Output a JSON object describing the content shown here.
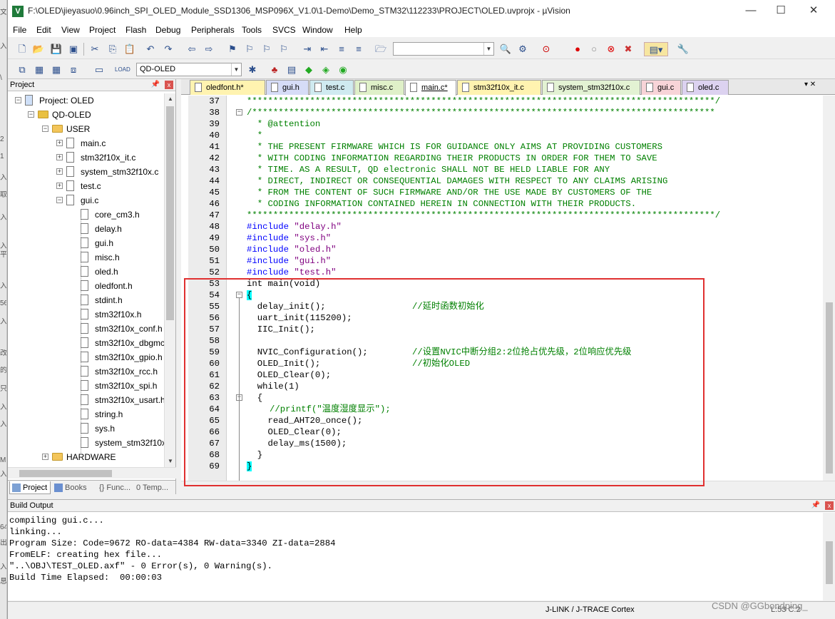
{
  "window": {
    "title": "F:\\OLED\\jieyasuo\\0.96inch_SPI_OLED_Module_SSD1306_MSP096X_V1.0\\1-Demo\\Demo_STM32\\112233\\PROJECT\\OLED.uvprojx - µVision",
    "app_icon": "V",
    "minimize": "—",
    "maximize": "☐",
    "close": "✕"
  },
  "left_strip": [
    "文",
    "入",
    "\\",
    "2",
    "1",
    "入",
    "取",
    "入",
    "入",
    "平",
    "入",
    "56",
    "入",
    "改",
    "的",
    "只",
    "入",
    "入",
    "M",
    "入",
    "64",
    "出",
    "入",
    "息"
  ],
  "menu": [
    "File",
    "Edit",
    "View",
    "Project",
    "Flash",
    "Debug",
    "Peripherals",
    "Tools",
    "SVCS",
    "Window",
    "Help"
  ],
  "toolbar": {
    "target_name": "QD-OLED"
  },
  "project_panel": {
    "title": "Project",
    "pin": "📌",
    "close": "x",
    "tree": [
      {
        "label": "Project: OLED",
        "level": 0,
        "kind": "root",
        "expand": "−"
      },
      {
        "label": "QD-OLED",
        "level": 1,
        "kind": "target",
        "expand": "−"
      },
      {
        "label": "USER",
        "level": 2,
        "kind": "folder",
        "expand": "−"
      },
      {
        "label": "main.c",
        "level": 3,
        "kind": "file",
        "expand": "+"
      },
      {
        "label": "stm32f10x_it.c",
        "level": 3,
        "kind": "file",
        "expand": "+"
      },
      {
        "label": "system_stm32f10x.c",
        "level": 3,
        "kind": "file",
        "expand": "+"
      },
      {
        "label": "test.c",
        "level": 3,
        "kind": "file",
        "expand": "+"
      },
      {
        "label": "gui.c",
        "level": 3,
        "kind": "file",
        "expand": "−"
      },
      {
        "label": "core_cm3.h",
        "level": 4,
        "kind": "header",
        "expand": ""
      },
      {
        "label": "delay.h",
        "level": 4,
        "kind": "header",
        "expand": ""
      },
      {
        "label": "gui.h",
        "level": 4,
        "kind": "header",
        "expand": ""
      },
      {
        "label": "misc.h",
        "level": 4,
        "kind": "header",
        "expand": ""
      },
      {
        "label": "oled.h",
        "level": 4,
        "kind": "header",
        "expand": ""
      },
      {
        "label": "oledfont.h",
        "level": 4,
        "kind": "header",
        "expand": ""
      },
      {
        "label": "stdint.h",
        "level": 4,
        "kind": "header",
        "expand": ""
      },
      {
        "label": "stm32f10x.h",
        "level": 4,
        "kind": "header",
        "expand": ""
      },
      {
        "label": "stm32f10x_conf.h",
        "level": 4,
        "kind": "header",
        "expand": ""
      },
      {
        "label": "stm32f10x_dbgmc",
        "level": 4,
        "kind": "header",
        "expand": ""
      },
      {
        "label": "stm32f10x_gpio.h",
        "level": 4,
        "kind": "header",
        "expand": ""
      },
      {
        "label": "stm32f10x_rcc.h",
        "level": 4,
        "kind": "header",
        "expand": ""
      },
      {
        "label": "stm32f10x_spi.h",
        "level": 4,
        "kind": "header",
        "expand": ""
      },
      {
        "label": "stm32f10x_usart.h",
        "level": 4,
        "kind": "header",
        "expand": ""
      },
      {
        "label": "string.h",
        "level": 4,
        "kind": "header",
        "expand": ""
      },
      {
        "label": "sys.h",
        "level": 4,
        "kind": "header",
        "expand": ""
      },
      {
        "label": "system_stm32f10x",
        "level": 4,
        "kind": "header",
        "expand": ""
      },
      {
        "label": "HARDWARE",
        "level": 2,
        "kind": "folder",
        "expand": "+"
      }
    ],
    "tabs": [
      "Project",
      "Books",
      "{} Func...",
      "0 Temp..."
    ]
  },
  "editor": {
    "tabs": [
      {
        "label": "oledfont.h*",
        "color": "#fff3b0"
      },
      {
        "label": "gui.h",
        "color": "#d6dcf7"
      },
      {
        "label": "test.c",
        "color": "#cfeaf0"
      },
      {
        "label": "misc.c",
        "color": "#dff0c8"
      },
      {
        "label": "main.c*",
        "color": "#ffffff",
        "active": true
      },
      {
        "label": "stm32f10x_it.c",
        "color": "#fff3b0"
      },
      {
        "label": "system_stm32f10x.c",
        "color": "#e3f2d3"
      },
      {
        "label": "gui.c",
        "color": "#f8d4d8"
      },
      {
        "label": "oled.c",
        "color": "#dcd2f0"
      }
    ],
    "tab_controls": "▾ ✕",
    "lines": [
      {
        "n": "37",
        "fold": "",
        "style": "green",
        "text": "*****************************************************************************************/"
      },
      {
        "n": "38",
        "fold": "−",
        "style": "green",
        "text": "/****************************************************************************************"
      },
      {
        "n": "39",
        "fold": "",
        "style": "green",
        "text": "  * @attention"
      },
      {
        "n": "40",
        "fold": "",
        "style": "green",
        "text": "  *"
      },
      {
        "n": "41",
        "fold": "",
        "style": "green",
        "text": "  * THE PRESENT FIRMWARE WHICH IS FOR GUIDANCE ONLY AIMS AT PROVIDING CUSTOMERS"
      },
      {
        "n": "42",
        "fold": "",
        "style": "green",
        "text": "  * WITH CODING INFORMATION REGARDING THEIR PRODUCTS IN ORDER FOR THEM TO SAVE"
      },
      {
        "n": "43",
        "fold": "",
        "style": "green",
        "text": "  * TIME. AS A RESULT, QD electronic SHALL NOT BE HELD LIABLE FOR ANY"
      },
      {
        "n": "44",
        "fold": "",
        "style": "green",
        "text": "  * DIRECT, INDIRECT OR CONSEQUENTIAL DAMAGES WITH RESPECT TO ANY CLAIMS ARISING"
      },
      {
        "n": "45",
        "fold": "",
        "style": "green",
        "text": "  * FROM THE CONTENT OF SUCH FIRMWARE AND/OR THE USE MADE BY CUSTOMERS OF THE"
      },
      {
        "n": "46",
        "fold": "",
        "style": "green",
        "text": "  * CODING INFORMATION CONTAINED HEREIN IN CONNECTION WITH THEIR PRODUCTS."
      },
      {
        "n": "47",
        "fold": "",
        "style": "green",
        "text": "*****************************************************************************************/"
      },
      {
        "n": "48",
        "fold": "",
        "style": "include",
        "kw": "#include ",
        "str": "\"delay.h\""
      },
      {
        "n": "49",
        "fold": "",
        "style": "include",
        "kw": "#include ",
        "str": "\"sys.h\""
      },
      {
        "n": "50",
        "fold": "",
        "style": "include",
        "kw": "#include ",
        "str": "\"oled.h\""
      },
      {
        "n": "51",
        "fold": "",
        "style": "include",
        "kw": "#include ",
        "str": "\"gui.h\""
      },
      {
        "n": "52",
        "fold": "",
        "style": "include",
        "kw": "#include ",
        "str": "\"test.h\""
      },
      {
        "n": "53",
        "fold": "",
        "style": "plain",
        "text": "int main(void)"
      },
      {
        "n": "54",
        "fold": "−",
        "style": "brace",
        "text": "{"
      },
      {
        "n": "55",
        "fold": "",
        "style": "code",
        "code": "  delay_init();",
        "comment": "//延时函数初始化"
      },
      {
        "n": "56",
        "fold": "",
        "style": "code",
        "code": "  uart_init(115200);",
        "comment": ""
      },
      {
        "n": "57",
        "fold": "",
        "style": "code",
        "code": "  IIC_Init();",
        "comment": ""
      },
      {
        "n": "58",
        "fold": "",
        "style": "code",
        "code": "",
        "comment": ""
      },
      {
        "n": "59",
        "fold": "",
        "style": "code",
        "code": "  NVIC_Configuration();",
        "comment": "//设置NVIC中断分组2:2位抢占优先级，2位响应优先级"
      },
      {
        "n": "60",
        "fold": "",
        "style": "code",
        "code": "  OLED_Init();",
        "comment": "//初始化OLED"
      },
      {
        "n": "61",
        "fold": "",
        "style": "code",
        "code": "  OLED_Clear(0);",
        "comment": ""
      },
      {
        "n": "62",
        "fold": "",
        "style": "code",
        "code": "  while(1)",
        "comment": ""
      },
      {
        "n": "63",
        "fold": "−",
        "style": "code",
        "code": "  {",
        "comment": ""
      },
      {
        "n": "64",
        "fold": "",
        "style": "code",
        "code": "    ",
        "comment": "//printf(\"温度湿度显示\");"
      },
      {
        "n": "65",
        "fold": "",
        "style": "code",
        "code": "    read_AHT20_once();",
        "comment": ""
      },
      {
        "n": "66",
        "fold": "",
        "style": "code",
        "code": "    OLED_Clear(0);",
        "comment": ""
      },
      {
        "n": "67",
        "fold": "",
        "style": "code",
        "code": "    delay_ms(1500);",
        "comment": ""
      },
      {
        "n": "68",
        "fold": "",
        "style": "code",
        "code": "  }",
        "comment": ""
      },
      {
        "n": "69",
        "fold": "",
        "style": "brace",
        "text": "}"
      }
    ]
  },
  "build_output": {
    "title": "Build Output",
    "pin": "📌",
    "close": "x",
    "lines": [
      "compiling gui.c...",
      "linking...",
      "Program Size: Code=9672 RO-data=4384 RW-data=3340 ZI-data=2884",
      "FromELF: creating hex file...",
      "\"..\\OBJ\\TEST_OLED.axf\" - 0 Error(s), 0 Warning(s).",
      "Build Time Elapsed:  00:00:03"
    ]
  },
  "statusbar": {
    "debugger": "J-LINK / J-TRACE Cortex",
    "position": "L:53 C:2"
  },
  "watermark": "CSDN @GGbondping_",
  "colors": {
    "highlight_box": "#e03030",
    "comment": "#008000",
    "keyword": "#0000ff",
    "string": "#800080"
  }
}
